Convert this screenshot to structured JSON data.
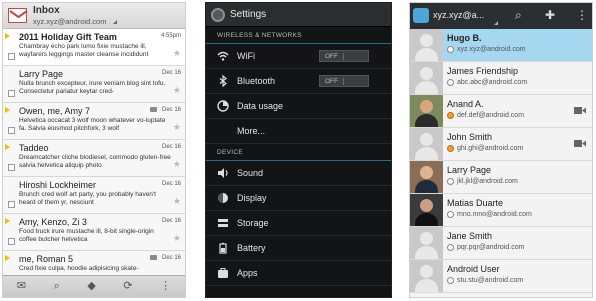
{
  "gmail": {
    "title": "Inbox",
    "account": "xyz.xyz@android.com",
    "messages": [
      {
        "from": "2011 Holiday Gift Team",
        "date": "4:55pm",
        "snippet": "Chambray echo park lomo fixie mustache ill, wayfarers leggings master cleanse incididunt",
        "unread": true
      },
      {
        "from": "Larry Page",
        "date": "Dec 16",
        "snippet": "Nulla brunch excepteur, irure veniam blog sint tofu. Consectetur pariatur keytar cred-",
        "unread": false
      },
      {
        "from": "Owen, me, Amy  7",
        "date": "Dec 16",
        "snippet": "Helvetica occacat 3 wolf moon whatever vo-luptate fa. Salvia eiusmod pitchfork, 3 wolf",
        "unread": false
      },
      {
        "from": "Taddeo",
        "date": "Dec 16",
        "snippet": "Dreamcatcher cliche biodiesel, commodo gluten-free salvia helvetica aliquip photo",
        "unread": false
      },
      {
        "from": "Hiroshi Lockheimer",
        "date": "Dec 16",
        "snippet": "Brunch cred wolf art party, you probably haven't heard of them yr, nesciunt",
        "unread": false
      },
      {
        "from": "Amy, Kenzo, Zi  3",
        "date": "Dec 16",
        "snippet": "Food truck irure mustache ill, 8-bit single-origin coffee butcher helvetica",
        "unread": false
      },
      {
        "from": "me, Roman  5",
        "date": "Dec 16",
        "snippet": "Cred fixie culpa, hoodie adipisicing skate-",
        "unread": false
      }
    ],
    "bottom_icons": [
      "compose-icon",
      "search-icon",
      "label-icon",
      "refresh-icon",
      "overflow-icon"
    ]
  },
  "settings": {
    "title": "Settings",
    "section1": "WIRELESS & NETWORKS",
    "wifi": {
      "label": "WiFi",
      "toggle": "OFF"
    },
    "bluetooth": {
      "label": "Bluetooth",
      "toggle": "OFF"
    },
    "data_usage": "Data usage",
    "more": "More...",
    "section2": "DEVICE",
    "sound": "Sound",
    "display": "Display",
    "storage": "Storage",
    "battery": "Battery",
    "apps": "Apps"
  },
  "contacts": {
    "account": "xyz.xyz@a...",
    "items": [
      {
        "name": "Hugo B.",
        "email": "xyz.xyz@android.com",
        "selected": true,
        "photo": false
      },
      {
        "name": "James Friendship",
        "email": "abc.abc@android.com",
        "selected": false,
        "photo": false
      },
      {
        "name": "Anand A.",
        "email": "def.def@android.com",
        "selected": false,
        "photo": true,
        "video": true
      },
      {
        "name": "John Smith",
        "email": "ghi.ghi@android.com",
        "selected": false,
        "photo": false,
        "video": true
      },
      {
        "name": "Larry Page",
        "email": "jkl.jkl@android.com",
        "selected": false,
        "photo": true
      },
      {
        "name": "Matias Duarte",
        "email": "mno.mno@android.com",
        "selected": false,
        "photo": true
      },
      {
        "name": "Jane Smith",
        "email": "pqr.pqr@android.com",
        "selected": false,
        "photo": false
      },
      {
        "name": "Android User",
        "email": "stu.stu@android.com",
        "selected": false,
        "photo": false
      }
    ]
  }
}
